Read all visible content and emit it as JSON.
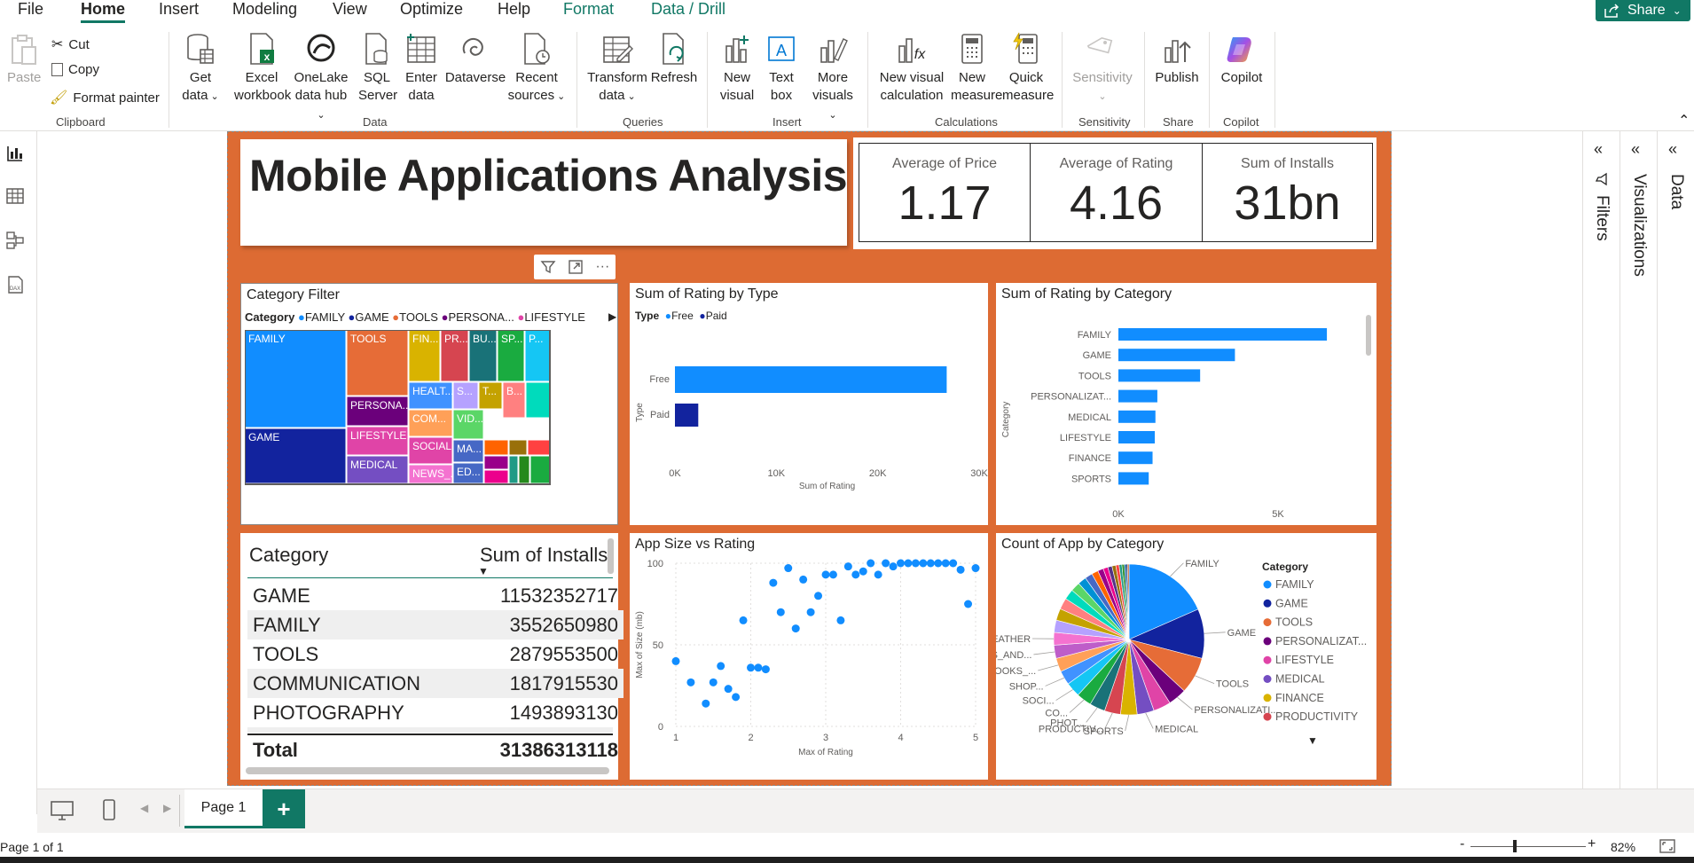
{
  "menu": {
    "tabs": [
      {
        "label": "File"
      },
      {
        "label": "Home"
      },
      {
        "label": "Insert"
      },
      {
        "label": "Modeling"
      },
      {
        "label": "View"
      },
      {
        "label": "Optimize"
      },
      {
        "label": "Help"
      },
      {
        "label": "Format"
      },
      {
        "label": "Data / Drill"
      }
    ],
    "share_label": "Share"
  },
  "ribbon": {
    "clipboard": {
      "paste": "Paste",
      "cut": "Cut",
      "copy": "Copy",
      "format_painter": "Format painter",
      "group": "Clipboard"
    },
    "data": {
      "get_data_1": "Get",
      "get_data_2": "data",
      "excel_1": "Excel",
      "excel_2": "workbook",
      "onelake_1": "OneLake",
      "onelake_2": "data hub",
      "sql_1": "SQL",
      "sql_2": "Server",
      "enter_1": "Enter",
      "enter_2": "data",
      "dataverse": "Dataverse",
      "recent_1": "Recent",
      "recent_2": "sources",
      "group": "Data"
    },
    "queries": {
      "transform_1": "Transform",
      "transform_2": "data",
      "refresh": "Refresh",
      "group": "Queries"
    },
    "insert": {
      "new_visual_1": "New",
      "new_visual_2": "visual",
      "text_box_1": "Text",
      "text_box_2": "box",
      "more_1": "More",
      "more_2": "visuals",
      "group": "Insert"
    },
    "calculations": {
      "new_calc_1": "New visual",
      "new_calc_2": "calculation",
      "new_measure_1": "New",
      "new_measure_2": "measure",
      "quick_1": "Quick",
      "quick_2": "measure",
      "group": "Calculations"
    },
    "sensitivity": {
      "label": "Sensitivity",
      "group": "Sensitivity"
    },
    "share": {
      "publish": "Publish",
      "group": "Share"
    },
    "copilot": {
      "label": "Copilot",
      "group": "Copilot"
    }
  },
  "report": {
    "title": "Mobile Applications Analysis",
    "kpis": [
      {
        "label": "Average of Price",
        "value": "1.17"
      },
      {
        "label": "Average of Rating",
        "value": "4.16"
      },
      {
        "label": "Sum of Installs",
        "value": "31bn"
      }
    ],
    "treemap": {
      "title": "Category Filter",
      "legend_title": "Category",
      "legend": [
        {
          "name": "FAMILY",
          "color": "#118dff"
        },
        {
          "name": "GAME",
          "color": "#12239e"
        },
        {
          "name": "TOOLS",
          "color": "#e66c37"
        },
        {
          "name": "PERSONA...",
          "color": "#6b007b"
        },
        {
          "name": "LIFESTYLE",
          "color": "#e044a7"
        }
      ],
      "tiles": [
        "FAMILY",
        "TOOLS",
        "FIN...",
        "PR...",
        "BU...",
        "SP...",
        "P...",
        "PERSONA...",
        "HEALT...",
        "S...",
        "T...",
        "B...",
        "GAME",
        "LIFESTYLE",
        "COM...",
        "VID...",
        "SOCIAL",
        "MA...",
        "MEDICAL",
        "NEWS_...",
        "ED..."
      ]
    },
    "table": {
      "headers": [
        "Category",
        "Sum of Installs"
      ],
      "rows": [
        [
          "GAME",
          "11532352717"
        ],
        [
          "FAMILY",
          "3552650980"
        ],
        [
          "TOOLS",
          "2879553500"
        ],
        [
          "COMMUNICATION",
          "1817915530"
        ],
        [
          "PHOTOGRAPHY",
          "1493893130"
        ]
      ],
      "total_label": "Total",
      "total_value": "31386313118"
    }
  },
  "chart_data": [
    {
      "type": "bar",
      "title": "Sum of Rating by Type",
      "legend_title": "Type",
      "categories": [
        "Free",
        "Paid"
      ],
      "values": [
        26800,
        2300
      ],
      "colors": [
        "#118dff",
        "#12239e"
      ],
      "xlabel": "Sum of Rating",
      "ylabel": "Type",
      "xticks": [
        "0K",
        "10K",
        "20K",
        "30K"
      ],
      "xlim": [
        0,
        30000
      ],
      "orientation": "horizontal"
    },
    {
      "type": "bar",
      "title": "Sum of Rating by Category",
      "categories": [
        "FAMILY",
        "GAME",
        "TOOLS",
        "PERSONALIZAT...",
        "MEDICAL",
        "LIFESTYLE",
        "FINANCE",
        "SPORTS"
      ],
      "values": [
        6530,
        3650,
        2560,
        1220,
        1160,
        1140,
        1070,
        950
      ],
      "color": "#118dff",
      "xlabel": "Sum of Rating",
      "ylabel": "Category",
      "xticks": [
        "0K",
        "5K"
      ],
      "xlim": [
        0,
        7000
      ],
      "orientation": "horizontal"
    },
    {
      "type": "scatter",
      "title": "App Size vs Rating",
      "xlabel": "Max of Rating",
      "ylabel": "Max of Size (mb)",
      "xlim": [
        1,
        5
      ],
      "ylim": [
        0,
        100
      ],
      "xticks": [
        "1",
        "2",
        "3",
        "4",
        "5"
      ],
      "yticks": [
        "0",
        "50",
        "100"
      ],
      "color": "#118dff",
      "points": [
        [
          1.0,
          40
        ],
        [
          1.2,
          27
        ],
        [
          1.4,
          14
        ],
        [
          1.5,
          27
        ],
        [
          1.6,
          37
        ],
        [
          1.7,
          23
        ],
        [
          1.8,
          18
        ],
        [
          1.9,
          65
        ],
        [
          2.0,
          36
        ],
        [
          2.1,
          36
        ],
        [
          2.2,
          35
        ],
        [
          2.3,
          88
        ],
        [
          2.4,
          70
        ],
        [
          2.5,
          97
        ],
        [
          2.6,
          60
        ],
        [
          2.7,
          90
        ],
        [
          2.8,
          70
        ],
        [
          2.9,
          80
        ],
        [
          3.0,
          93
        ],
        [
          3.1,
          93
        ],
        [
          3.2,
          65
        ],
        [
          3.3,
          98
        ],
        [
          3.4,
          93
        ],
        [
          3.5,
          95
        ],
        [
          3.6,
          100
        ],
        [
          3.7,
          93
        ],
        [
          3.8,
          100
        ],
        [
          3.9,
          98
        ],
        [
          4.0,
          100
        ],
        [
          4.1,
          100
        ],
        [
          4.2,
          100
        ],
        [
          4.3,
          100
        ],
        [
          4.4,
          100
        ],
        [
          4.5,
          100
        ],
        [
          4.6,
          100
        ],
        [
          4.7,
          100
        ],
        [
          4.8,
          96
        ],
        [
          4.9,
          75
        ],
        [
          5.0,
          97
        ]
      ]
    },
    {
      "type": "pie",
      "title": "Count of App by Category",
      "legend_title": "Category",
      "legend": [
        "FAMILY",
        "GAME",
        "TOOLS",
        "PERSONALIZAT...",
        "LIFESTYLE",
        "MEDICAL",
        "FINANCE",
        "PRODUCTIVITY"
      ],
      "slice_labels": [
        "FAMILY",
        "GAME",
        "TOOLS",
        "PERSONALIZATI...",
        "MEDICAL",
        "PRODUCTIV...",
        "SPORTS",
        "PHOT...",
        "CO...",
        "SOCI...",
        "SHOP...",
        "BOOKS_...",
        "MAPS_AND...",
        "WEATHER"
      ],
      "values": [
        18.2,
        10.5,
        7.8,
        3.9,
        3.7,
        3.6,
        3.5,
        3.4,
        3.3,
        3.2,
        3.1,
        3.0,
        2.9,
        2.8,
        2.7,
        2.6,
        2.5,
        2.4,
        2.2,
        2.0,
        1.8,
        1.6,
        1.4,
        1.2,
        1.0,
        0.9,
        0.8,
        0.7,
        0.6,
        0.5,
        0.4,
        0.3,
        0.3
      ],
      "colors": [
        "#118dff",
        "#12239e",
        "#e66c37",
        "#6b007b",
        "#e044a7",
        "#744ec2",
        "#d9b300",
        "#d64550",
        "#197278",
        "#1aab40",
        "#15c6f4",
        "#4092ff",
        "#ffa058",
        "#be5dc9",
        "#f472d0",
        "#b5a1ff",
        "#c4a200",
        "#ff8080",
        "#00dbbc",
        "#5bd667",
        "#0091d5",
        "#4668c5",
        "#ff6300",
        "#99008a",
        "#ec008c",
        "#533285",
        "#99700a",
        "#ff4141",
        "#1f9a85",
        "#25891c",
        "#0057a2",
        "#002050",
        "#c94f0f"
      ]
    }
  ],
  "panes": {
    "filters": "Filters",
    "visualizations": "Visualizations",
    "data": "Data"
  },
  "footer": {
    "page_tab": "Page 1",
    "page_status": "Page 1 of 1",
    "zoom": "82%"
  }
}
